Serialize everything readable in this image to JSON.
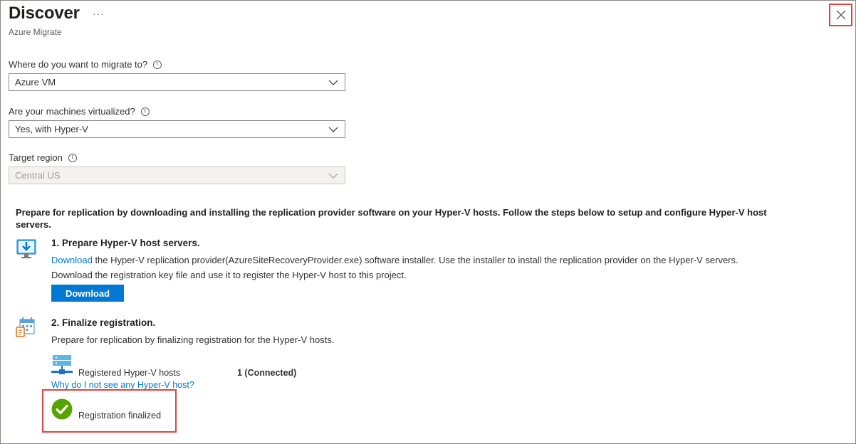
{
  "header": {
    "title": "Discover",
    "more": "···",
    "subtitle": "Azure Migrate"
  },
  "fields": {
    "migrate_to": {
      "label": "Where do you want to migrate to?",
      "value": "Azure VM"
    },
    "virtualized": {
      "label": "Are your machines virtualized?",
      "value": "Yes, with Hyper-V"
    },
    "target_region": {
      "label": "Target region",
      "value": "Central US",
      "disabled": true
    }
  },
  "instructions": "Prepare for replication by downloading and installing the replication provider software on your Hyper-V hosts. Follow the steps below to setup and configure Hyper-V host servers.",
  "step1": {
    "title": "1. Prepare Hyper-V host servers.",
    "link_text": "Download",
    "line1_rest": " the Hyper-V replication provider(AzureSiteRecoveryProvider.exe) software installer. Use the installer to install the replication provider on the Hyper-V servers.",
    "line2": "Download the registration key file and use it to register the Hyper-V host to this project.",
    "button_label": "Download"
  },
  "step2": {
    "title": "2. Finalize registration.",
    "description": "Prepare for replication by finalizing registration for the Hyper-V hosts.",
    "hosts_label": "Registered Hyper-V hosts",
    "hosts_value": "1 (Connected)",
    "help_link": "Why do I not see any Hyper-V host?",
    "status": "Registration finalized"
  },
  "colors": {
    "accent": "#0078d4",
    "success": "#57a300",
    "highlight": "#e8403d"
  }
}
